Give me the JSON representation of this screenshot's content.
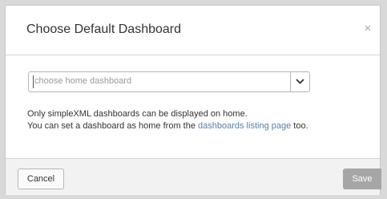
{
  "dialog": {
    "title": "Choose Default Dashboard",
    "close_label": "×"
  },
  "select": {
    "placeholder": "choose home dashboard"
  },
  "help": {
    "line1": "Only simpleXML dashboards can be displayed on home.",
    "line2_prefix": "You can set a dashboard as home from the ",
    "link_text": "dashboards listing page",
    "line2_suffix": " too."
  },
  "footer": {
    "cancel_label": "Cancel",
    "save_label": "Save"
  },
  "colors": {
    "link": "#5a7fa8",
    "save_disabled": "#a6a6a6"
  }
}
